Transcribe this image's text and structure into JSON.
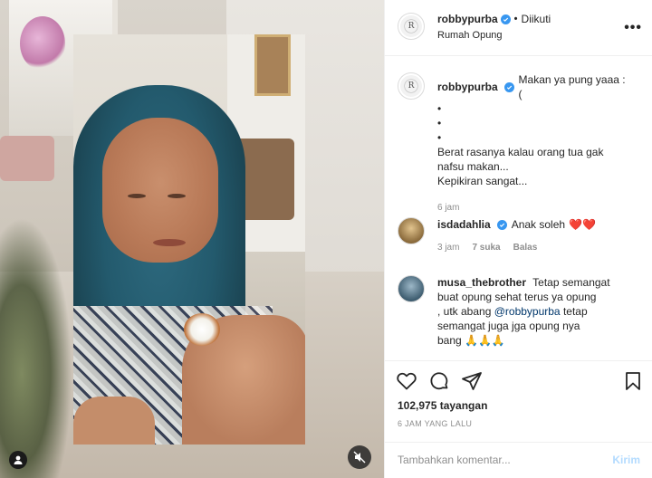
{
  "post": {
    "username": "robbypurba",
    "follow_status": "Diikuti",
    "separator": "•",
    "location": "Rumah Opung",
    "more_label": "•••"
  },
  "caption": {
    "username": "robbypurba",
    "lines": [
      "Makan ya pung yaaa :(",
      "•",
      "•",
      "•",
      "Berat rasanya kalau orang tua gak",
      "nafsu makan...",
      "Kepikiran sangat..."
    ],
    "time": "6 jam"
  },
  "comments": [
    {
      "username": "isdadahlia",
      "text": "Anak soleh",
      "emoji": "❤️❤️",
      "time": "3 jam",
      "likes": "7 suka",
      "reply": "Balas"
    },
    {
      "username": "musa_thebrother",
      "text_parts": {
        "line1": "Tetap semangat",
        "line2": "buat opung sehat terus ya opung",
        "line3_pre": ", utk abang ",
        "mention": "@robbypurba",
        "line3_post": " tetap",
        "line4": "semangat juga jga opung nya",
        "line5": "bang 🙏🙏🙏"
      }
    }
  ],
  "stats": {
    "views": "102,975 tayangan",
    "time_ago": "6 JAM YANG LALU"
  },
  "add_comment": {
    "placeholder": "Tambahkan komentar...",
    "post_label": "Kirim"
  },
  "icons": {
    "verified": "verified-badge-icon",
    "like": "heart-icon",
    "comment": "comment-icon",
    "share": "paper-plane-icon",
    "save": "bookmark-icon",
    "mute": "muted-speaker-icon",
    "tag": "user-tag-icon"
  },
  "colors": {
    "verified": "#3897f0",
    "secondary_text": "#8e8e8e",
    "post_disabled": "#b3dbff",
    "mention": "#00376b",
    "heart_emoji": "#e0245e"
  }
}
